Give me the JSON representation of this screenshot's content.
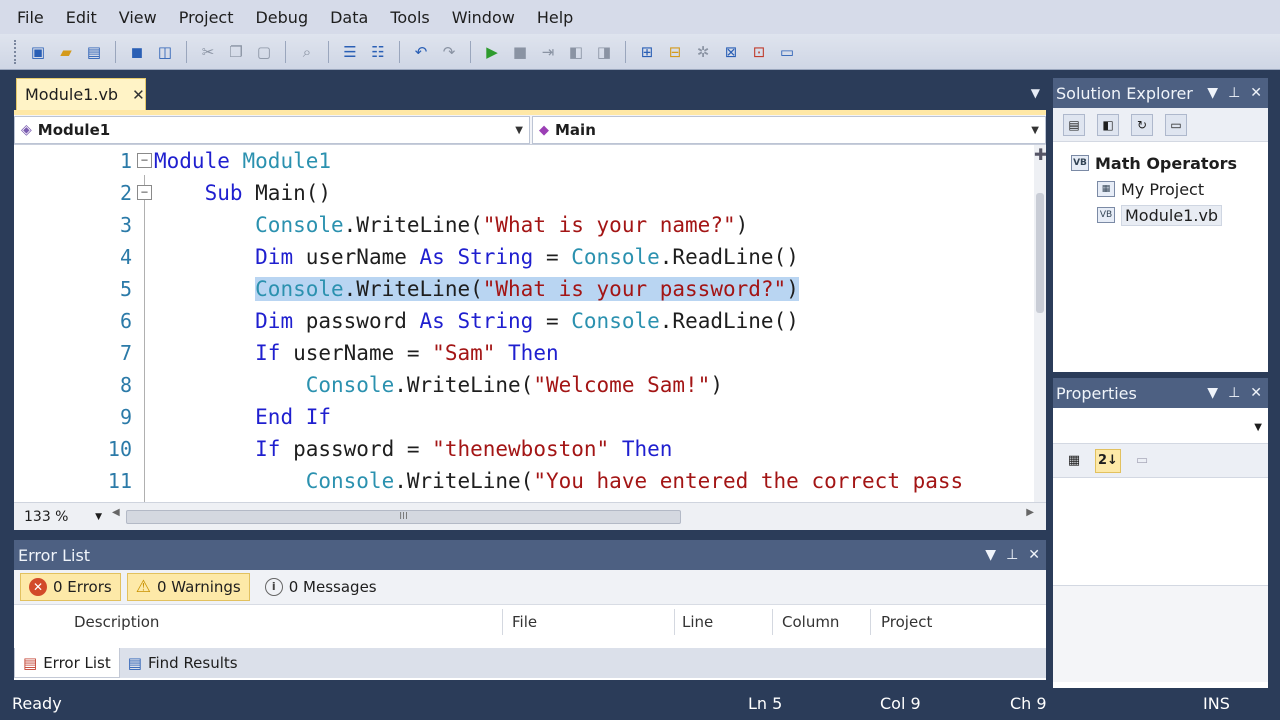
{
  "menu": [
    "File",
    "Edit",
    "View",
    "Project",
    "Debug",
    "Data",
    "Tools",
    "Window",
    "Help"
  ],
  "toolbar": {
    "icons": [
      "new-project-icon",
      "open-file-icon",
      "add-item-icon",
      "save-icon",
      "save-all-icon",
      "cut-icon",
      "copy-icon",
      "paste-icon",
      "find-icon",
      "comment-icon",
      "uncomment-icon",
      "undo-icon",
      "redo-icon",
      "start-debugging-icon",
      "stop-icon",
      "step-icon",
      "breakpoint-icon",
      "bookmark-icon",
      "solution-explorer-icon",
      "properties-icon",
      "object-browser-icon",
      "toolbox-icon",
      "error-list-icon",
      "start-page-icon"
    ]
  },
  "editor": {
    "tab": {
      "label": "Module1.vb",
      "close": "✕"
    },
    "nav": {
      "type_label": "Module1",
      "member_label": "Main"
    },
    "line_numbers": [
      "1",
      "2",
      "3",
      "4",
      "5",
      "6",
      "7",
      "8",
      "9",
      "10",
      "11"
    ],
    "lines": [
      {
        "indent": "",
        "tokens": [
          [
            "kw",
            "Module "
          ],
          [
            "ty",
            "Module1"
          ]
        ]
      },
      {
        "indent": "    ",
        "tokens": [
          [
            "kw",
            "Sub "
          ],
          [
            "",
            "Main()"
          ]
        ]
      },
      {
        "indent": "        ",
        "tokens": [
          [
            "ty",
            "Console"
          ],
          [
            "",
            ".WriteLine("
          ],
          [
            "str",
            "\"What is your name?\""
          ],
          [
            "",
            ")"
          ]
        ]
      },
      {
        "indent": "        ",
        "tokens": [
          [
            "kw",
            "Dim "
          ],
          [
            "",
            "userName "
          ],
          [
            "kw",
            "As "
          ],
          [
            "kw",
            "String"
          ],
          [
            "",
            " = "
          ],
          [
            "ty",
            "Console"
          ],
          [
            "",
            ".ReadLine()"
          ]
        ]
      },
      {
        "indent": "        ",
        "highlight": true,
        "tokens": [
          [
            "ty",
            "Console"
          ],
          [
            "",
            ".WriteLine("
          ],
          [
            "str",
            "\"What is your password?\""
          ],
          [
            "",
            ")"
          ]
        ]
      },
      {
        "indent": "        ",
        "tokens": [
          [
            "kw",
            "Dim "
          ],
          [
            "",
            "password "
          ],
          [
            "kw",
            "As "
          ],
          [
            "kw",
            "String"
          ],
          [
            "",
            " = "
          ],
          [
            "ty",
            "Console"
          ],
          [
            "",
            ".ReadLine()"
          ]
        ]
      },
      {
        "indent": "        ",
        "tokens": [
          [
            "kw",
            "If "
          ],
          [
            "",
            "userName = "
          ],
          [
            "str",
            "\"Sam\""
          ],
          [
            "kw",
            " Then"
          ]
        ]
      },
      {
        "indent": "            ",
        "tokens": [
          [
            "ty",
            "Console"
          ],
          [
            "",
            ".WriteLine("
          ],
          [
            "str",
            "\"Welcome Sam!\""
          ],
          [
            "",
            ")"
          ]
        ]
      },
      {
        "indent": "        ",
        "tokens": [
          [
            "kw",
            "End If"
          ]
        ]
      },
      {
        "indent": "        ",
        "tokens": [
          [
            "kw",
            "If "
          ],
          [
            "",
            "password = "
          ],
          [
            "str",
            "\"thenewboston\""
          ],
          [
            "kw",
            " Then"
          ]
        ]
      },
      {
        "indent": "            ",
        "tokens": [
          [
            "ty",
            "Console"
          ],
          [
            "",
            ".WriteLine("
          ],
          [
            "str",
            "\"You have entered the correct pass"
          ]
        ]
      }
    ],
    "zoom": "133 %",
    "scroll_grip": "III"
  },
  "error_list": {
    "title": "Error List",
    "filters": {
      "errors": "0 Errors",
      "warnings": "0 Warnings",
      "messages": "0 Messages"
    },
    "columns": {
      "description": "Description",
      "file": "File",
      "line": "Line",
      "column": "Column",
      "project": "Project"
    }
  },
  "bottom_tabs": {
    "error_list": "Error List",
    "find_results": "Find Results"
  },
  "solution_explorer": {
    "title": "Solution Explorer",
    "root": "Math Operators",
    "items": [
      "My Project",
      "Module1.vb"
    ]
  },
  "properties": {
    "title": "Properties",
    "sort_label": "2↓"
  },
  "status": {
    "ready": "Ready",
    "ln": "Ln 5",
    "col": "Col 9",
    "ch": "Ch 9",
    "ins": "INS"
  },
  "colors": {
    "chrome": "#2b3c59",
    "panel_header": "#4d6082",
    "tab_active": "#fff3c6",
    "selection": "#b9d5f2",
    "keyword": "#1f1fcf",
    "type": "#2b91af",
    "string": "#a31515"
  }
}
